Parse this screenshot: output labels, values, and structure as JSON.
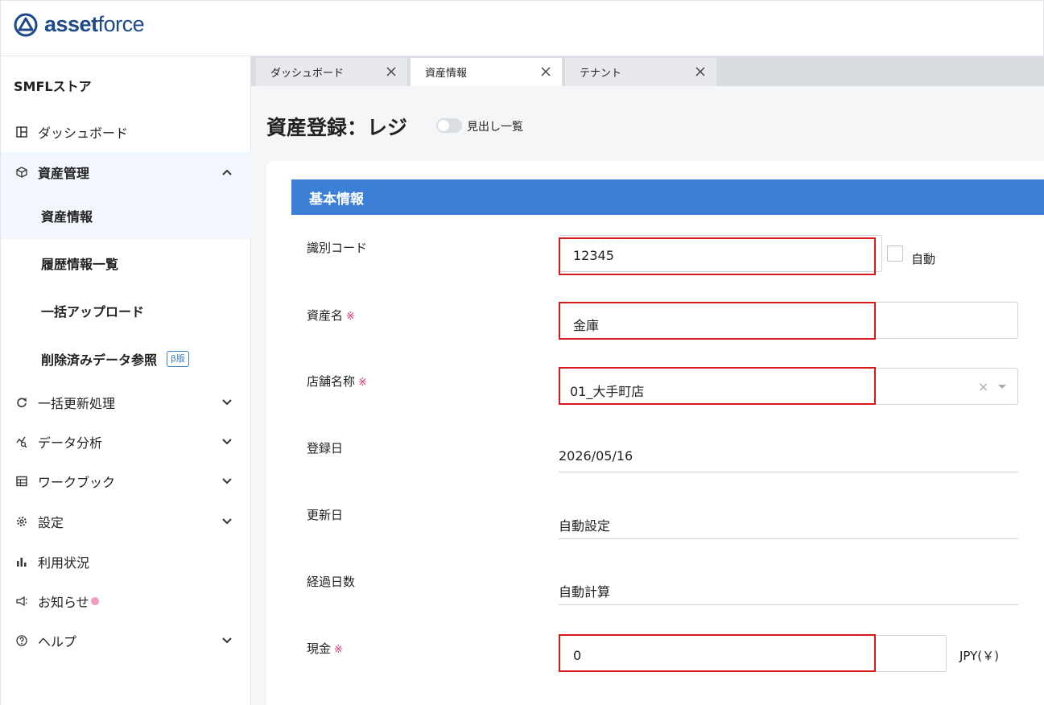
{
  "app": {
    "logo_bold": "asset",
    "logo_light": "force"
  },
  "sidebar": {
    "store_name": "SMFLストア",
    "items": [
      {
        "label": "ダッシュボード",
        "icon": "dashboard-icon"
      },
      {
        "label": "資産管理",
        "icon": "cube-icon",
        "expanded": true
      },
      {
        "label": "資産情報"
      },
      {
        "label": "履歴情報一覧"
      },
      {
        "label": "一括アップロード"
      },
      {
        "label": "削除済みデータ参照",
        "badge": "β版"
      },
      {
        "label": "一括更新処理",
        "icon": "refresh-icon"
      },
      {
        "label": "データ分析",
        "icon": "analytics-icon"
      },
      {
        "label": "ワークブック",
        "icon": "table-icon"
      },
      {
        "label": "設定",
        "icon": "gear-icon"
      },
      {
        "label": "利用状況",
        "icon": "bar-chart-icon"
      },
      {
        "label": "お知らせ",
        "icon": "megaphone-icon"
      },
      {
        "label": "ヘルプ",
        "icon": "help-icon"
      }
    ]
  },
  "tabs": [
    {
      "label": "ダッシュボード"
    },
    {
      "label": "資産情報",
      "active": true
    },
    {
      "label": "テナント"
    }
  ],
  "page": {
    "title": "資産登録：レジ",
    "toggle_label": "見出し一覧"
  },
  "form": {
    "section_title": "基本情報",
    "required_mark": "※",
    "fields": {
      "code": {
        "label": "識別コード",
        "value": "12345",
        "auto_label": "自動"
      },
      "name": {
        "label": "資産名",
        "value": "金庫"
      },
      "store": {
        "label": "店舗名称",
        "value": "01_大手町店"
      },
      "registered": {
        "label": "登録日",
        "value": "2026/05/16"
      },
      "updated": {
        "label": "更新日",
        "value": "自動設定"
      },
      "elapsed": {
        "label": "経過日数",
        "value": "自動計算"
      },
      "cash": {
        "label": "現金",
        "value": "0",
        "unit": "JPY(￥)"
      }
    }
  },
  "colors": {
    "accent": "#3b7fd6",
    "highlight": "#d7191d",
    "required": "#e2336b"
  }
}
